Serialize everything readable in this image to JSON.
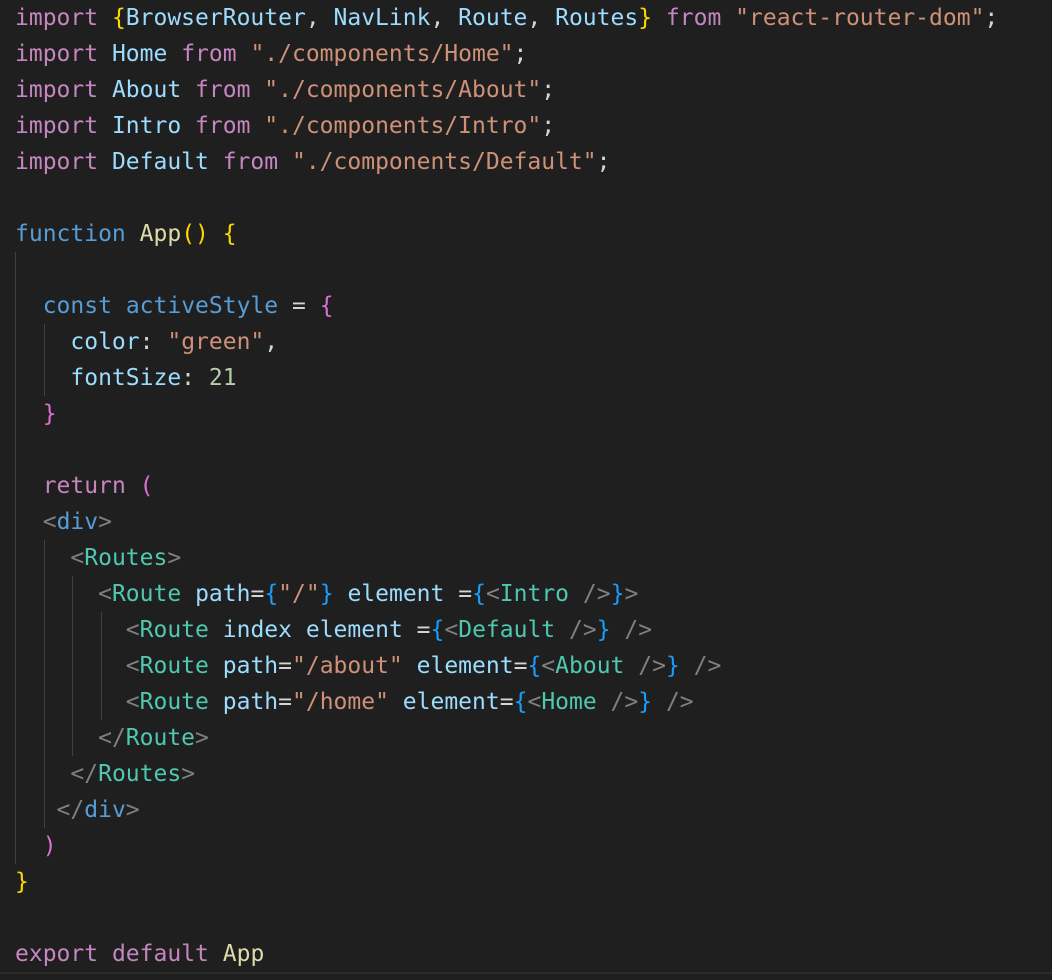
{
  "editor": {
    "language": "javascript-jsx",
    "colors": {
      "background": "#1f1f1f",
      "keyword_control": "#c586c0",
      "keyword_storage": "#569cd6",
      "identifier": "#9cdcfe",
      "function": "#dcdcaa",
      "string": "#ce9178",
      "number": "#b5cea8",
      "tag": "#4ec9b0",
      "tag_bracket": "#808080",
      "bracket_gold": "#ffd700",
      "bracket_purple": "#da70d6",
      "bracket_blue": "#179fff",
      "plain": "#d4d4d4",
      "indent_guide": "#404040"
    },
    "lines": [
      [
        [
          "import ",
          "keyword_control"
        ],
        [
          "{",
          "bracket_gold"
        ],
        [
          "BrowserRouter",
          "identifier"
        ],
        [
          ", ",
          "plain"
        ],
        [
          "NavLink",
          "identifier"
        ],
        [
          ", ",
          "plain"
        ],
        [
          "Route",
          "identifier"
        ],
        [
          ", ",
          "plain"
        ],
        [
          "Routes",
          "identifier"
        ],
        [
          "}",
          "bracket_gold"
        ],
        [
          " ",
          "plain"
        ],
        [
          "from",
          "keyword_control"
        ],
        [
          " ",
          "plain"
        ],
        [
          "\"react-router-dom\"",
          "string"
        ],
        [
          ";",
          "plain"
        ]
      ],
      [
        [
          "import ",
          "keyword_control"
        ],
        [
          "Home",
          "identifier"
        ],
        [
          " ",
          "plain"
        ],
        [
          "from",
          "keyword_control"
        ],
        [
          " ",
          "plain"
        ],
        [
          "\"./components/Home\"",
          "string"
        ],
        [
          ";",
          "plain"
        ]
      ],
      [
        [
          "import ",
          "keyword_control"
        ],
        [
          "About",
          "identifier"
        ],
        [
          " ",
          "plain"
        ],
        [
          "from",
          "keyword_control"
        ],
        [
          " ",
          "plain"
        ],
        [
          "\"./components/About\"",
          "string"
        ],
        [
          ";",
          "plain"
        ]
      ],
      [
        [
          "import ",
          "keyword_control"
        ],
        [
          "Intro",
          "identifier"
        ],
        [
          " ",
          "plain"
        ],
        [
          "from",
          "keyword_control"
        ],
        [
          " ",
          "plain"
        ],
        [
          "\"./components/Intro\"",
          "string"
        ],
        [
          ";",
          "plain"
        ]
      ],
      [
        [
          "import ",
          "keyword_control"
        ],
        [
          "Default",
          "identifier"
        ],
        [
          " ",
          "plain"
        ],
        [
          "from",
          "keyword_control"
        ],
        [
          " ",
          "plain"
        ],
        [
          "\"./components/Default\"",
          "string"
        ],
        [
          ";",
          "plain"
        ]
      ],
      [],
      [
        [
          "function",
          "keyword_storage"
        ],
        [
          " ",
          "plain"
        ],
        [
          "App",
          "function"
        ],
        [
          "()",
          "bracket_gold"
        ],
        [
          " ",
          "plain"
        ],
        [
          "{",
          "bracket_gold"
        ]
      ],
      [],
      [
        [
          "  ",
          "plain"
        ],
        [
          "const",
          "keyword_storage"
        ],
        [
          " ",
          "plain"
        ],
        [
          "activeStyle",
          "keyword_storage"
        ],
        [
          " = ",
          "plain"
        ],
        [
          "{",
          "bracket_purple"
        ]
      ],
      [
        [
          "    ",
          "plain"
        ],
        [
          "color",
          "identifier"
        ],
        [
          ": ",
          "plain"
        ],
        [
          "\"green\"",
          "string"
        ],
        [
          ",",
          "plain"
        ]
      ],
      [
        [
          "    ",
          "plain"
        ],
        [
          "fontSize",
          "identifier"
        ],
        [
          ": ",
          "plain"
        ],
        [
          "21",
          "number"
        ]
      ],
      [
        [
          "  ",
          "plain"
        ],
        [
          "}",
          "bracket_purple"
        ]
      ],
      [],
      [
        [
          "  ",
          "plain"
        ],
        [
          "return",
          "keyword_control"
        ],
        [
          " ",
          "plain"
        ],
        [
          "(",
          "bracket_purple"
        ]
      ],
      [
        [
          "  ",
          "plain"
        ],
        [
          "<",
          "tag_bracket"
        ],
        [
          "div",
          "keyword_storage"
        ],
        [
          ">",
          "tag_bracket"
        ]
      ],
      [
        [
          "    ",
          "plain"
        ],
        [
          "<",
          "tag_bracket"
        ],
        [
          "Routes",
          "tag"
        ],
        [
          ">",
          "tag_bracket"
        ]
      ],
      [
        [
          "      ",
          "plain"
        ],
        [
          "<",
          "tag_bracket"
        ],
        [
          "Route",
          "tag"
        ],
        [
          " ",
          "plain"
        ],
        [
          "path",
          "identifier"
        ],
        [
          "=",
          "plain"
        ],
        [
          "{",
          "bracket_blue"
        ],
        [
          "\"/\"",
          "string"
        ],
        [
          "}",
          "bracket_blue"
        ],
        [
          " ",
          "plain"
        ],
        [
          "element",
          "identifier"
        ],
        [
          " =",
          "plain"
        ],
        [
          "{",
          "bracket_blue"
        ],
        [
          "<",
          "tag_bracket"
        ],
        [
          "Intro",
          "tag"
        ],
        [
          " />",
          "tag_bracket"
        ],
        [
          "}",
          "bracket_blue"
        ],
        [
          ">",
          "tag_bracket"
        ]
      ],
      [
        [
          "        ",
          "plain"
        ],
        [
          "<",
          "tag_bracket"
        ],
        [
          "Route",
          "tag"
        ],
        [
          " ",
          "plain"
        ],
        [
          "index",
          "identifier"
        ],
        [
          " ",
          "plain"
        ],
        [
          "element",
          "identifier"
        ],
        [
          " =",
          "plain"
        ],
        [
          "{",
          "bracket_blue"
        ],
        [
          "<",
          "tag_bracket"
        ],
        [
          "Default",
          "tag"
        ],
        [
          " />",
          "tag_bracket"
        ],
        [
          "}",
          "bracket_blue"
        ],
        [
          " />",
          "tag_bracket"
        ]
      ],
      [
        [
          "        ",
          "plain"
        ],
        [
          "<",
          "tag_bracket"
        ],
        [
          "Route",
          "tag"
        ],
        [
          " ",
          "plain"
        ],
        [
          "path",
          "identifier"
        ],
        [
          "=",
          "plain"
        ],
        [
          "\"/about\"",
          "string"
        ],
        [
          " ",
          "plain"
        ],
        [
          "element",
          "identifier"
        ],
        [
          "=",
          "plain"
        ],
        [
          "{",
          "bracket_blue"
        ],
        [
          "<",
          "tag_bracket"
        ],
        [
          "About",
          "tag"
        ],
        [
          " />",
          "tag_bracket"
        ],
        [
          "}",
          "bracket_blue"
        ],
        [
          " />",
          "tag_bracket"
        ]
      ],
      [
        [
          "        ",
          "plain"
        ],
        [
          "<",
          "tag_bracket"
        ],
        [
          "Route",
          "tag"
        ],
        [
          " ",
          "plain"
        ],
        [
          "path",
          "identifier"
        ],
        [
          "=",
          "plain"
        ],
        [
          "\"/home\"",
          "string"
        ],
        [
          " ",
          "plain"
        ],
        [
          "element",
          "identifier"
        ],
        [
          "=",
          "plain"
        ],
        [
          "{",
          "bracket_blue"
        ],
        [
          "<",
          "tag_bracket"
        ],
        [
          "Home",
          "tag"
        ],
        [
          " />",
          "tag_bracket"
        ],
        [
          "}",
          "bracket_blue"
        ],
        [
          " />",
          "tag_bracket"
        ]
      ],
      [
        [
          "      ",
          "plain"
        ],
        [
          "</",
          "tag_bracket"
        ],
        [
          "Route",
          "tag"
        ],
        [
          ">",
          "tag_bracket"
        ]
      ],
      [
        [
          "    ",
          "plain"
        ],
        [
          "</",
          "tag_bracket"
        ],
        [
          "Routes",
          "tag"
        ],
        [
          ">",
          "tag_bracket"
        ]
      ],
      [
        [
          "   ",
          "plain"
        ],
        [
          "</",
          "tag_bracket"
        ],
        [
          "div",
          "keyword_storage"
        ],
        [
          ">",
          "tag_bracket"
        ]
      ],
      [
        [
          "  ",
          "plain"
        ],
        [
          ")",
          "bracket_purple"
        ]
      ],
      [
        [
          "}",
          "bracket_gold"
        ]
      ],
      [],
      [
        [
          "export",
          "keyword_control"
        ],
        [
          " ",
          "plain"
        ],
        [
          "default",
          "keyword_control"
        ],
        [
          " ",
          "plain"
        ],
        [
          "App",
          "function"
        ]
      ]
    ]
  }
}
